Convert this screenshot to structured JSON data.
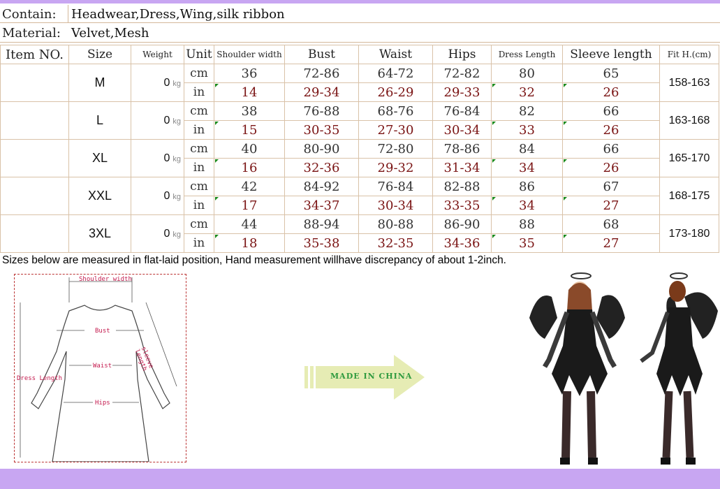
{
  "info": {
    "contain_label": "Contain:",
    "contain_value": "Headwear,Dress,Wing,silk ribbon",
    "material_label": "Material:",
    "material_value": "Velvet,Mesh"
  },
  "headers": {
    "item": "Item NO.",
    "size": "Size",
    "weight": "Weight",
    "unit": "Unit",
    "shoulder": "Shoulder width",
    "bust": "Bust",
    "waist": "Waist",
    "hips": "Hips",
    "dress_length": "Dress Length",
    "sleeve": "Sleeve length",
    "fit": "Fit H.(cm)"
  },
  "rows": [
    {
      "size": "M",
      "weight": "0",
      "weight_unit": "kg",
      "unit_cm": "cm",
      "unit_in": "in",
      "fit": "158-163",
      "cm": {
        "shoulder": "36",
        "bust": "72-86",
        "waist": "64-72",
        "hips": "72-82",
        "dress": "80",
        "sleeve": "65"
      },
      "in": {
        "shoulder": "14",
        "bust": "29-34",
        "waist": "26-29",
        "hips": "29-33",
        "dress": "32",
        "sleeve": "26"
      }
    },
    {
      "size": "L",
      "weight": "0",
      "weight_unit": "kg",
      "unit_cm": "cm",
      "unit_in": "in",
      "fit": "163-168",
      "cm": {
        "shoulder": "38",
        "bust": "76-88",
        "waist": "68-76",
        "hips": "76-84",
        "dress": "82",
        "sleeve": "66"
      },
      "in": {
        "shoulder": "15",
        "bust": "30-35",
        "waist": "27-30",
        "hips": "30-34",
        "dress": "33",
        "sleeve": "26"
      }
    },
    {
      "size": "XL",
      "weight": "0",
      "weight_unit": "kg",
      "unit_cm": "cm",
      "unit_in": "in",
      "fit": "165-170",
      "cm": {
        "shoulder": "40",
        "bust": "80-90",
        "waist": "72-80",
        "hips": "78-86",
        "dress": "84",
        "sleeve": "66"
      },
      "in": {
        "shoulder": "16",
        "bust": "32-36",
        "waist": "29-32",
        "hips": "31-34",
        "dress": "34",
        "sleeve": "26"
      }
    },
    {
      "size": "XXL",
      "weight": "0",
      "weight_unit": "kg",
      "unit_cm": "cm",
      "unit_in": "in",
      "fit": "168-175",
      "cm": {
        "shoulder": "42",
        "bust": "84-92",
        "waist": "76-84",
        "hips": "82-88",
        "dress": "86",
        "sleeve": "67"
      },
      "in": {
        "shoulder": "17",
        "bust": "34-37",
        "waist": "30-34",
        "hips": "33-35",
        "dress": "34",
        "sleeve": "27"
      }
    },
    {
      "size": "3XL",
      "weight": "0",
      "weight_unit": "kg",
      "unit_cm": "cm",
      "unit_in": "in",
      "fit": "173-180",
      "cm": {
        "shoulder": "44",
        "bust": "88-94",
        "waist": "80-88",
        "hips": "86-90",
        "dress": "88",
        "sleeve": "68"
      },
      "in": {
        "shoulder": "18",
        "bust": "35-38",
        "waist": "32-35",
        "hips": "34-36",
        "dress": "35",
        "sleeve": "27"
      }
    }
  ],
  "note": "Sizes below are measured in flat-laid position, Hand measurement willhave discrepancy of about 1-2inch.",
  "diagram": {
    "shoulder_label": "Shoulder width",
    "bust_label": "Bust",
    "waist_label": "Waist",
    "hips_label": "Hips",
    "dress_label": "Dress Length",
    "sleeve_label": "sleeve length"
  },
  "badge": "MADE IN CHINA",
  "colors": {
    "accent_bar": "#c8a6f2",
    "border": "#d9c2a8",
    "inch_text": "#7a1414",
    "arrow": "#e6ecb4",
    "badge_text": "#2e9a3e",
    "label": "#c41a4e"
  }
}
